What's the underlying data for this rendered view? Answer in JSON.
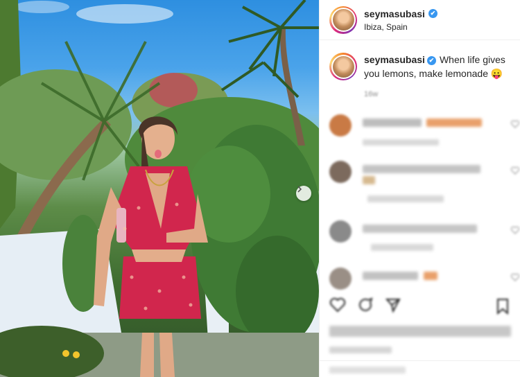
{
  "post": {
    "username": "seymasubasi",
    "verified_mark": "✔",
    "location": "Ibiza, Spain",
    "caption": "When life gives you lemons, make lemonade 😛",
    "time_ago": "16w"
  },
  "photo": {
    "description_icons": [
      "palm-tree",
      "vine-wall",
      "woman-in-red-outfit"
    ],
    "next_icon": "chevron-right-icon"
  },
  "comments_blurred": true,
  "colors": {
    "verified": "#3897f0",
    "dress": "#d1264d",
    "sky": "#3a97e4",
    "foliage": "#3f7a34"
  }
}
